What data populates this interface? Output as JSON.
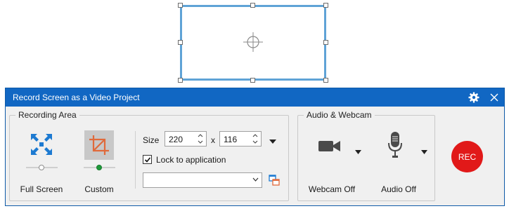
{
  "window": {
    "title": "Record Screen as a Video Project"
  },
  "icons": {
    "settings": "gear-icon",
    "close": "close-icon"
  },
  "recording_area": {
    "legend": "Recording Area",
    "full_screen_label": "Full Screen",
    "custom_label": "Custom",
    "size_label": "Size",
    "width_value": "220",
    "times": "x",
    "height_value": "116",
    "lock_label": "Lock to application",
    "lock_checked": true,
    "application_value": ""
  },
  "audio_webcam": {
    "legend": "Audio & Webcam",
    "webcam_label": "Webcam Off",
    "audio_label": "Audio Off"
  },
  "rec_button": {
    "label": "REC"
  },
  "colors": {
    "titlebar": "#1167c3",
    "accent_blue": "#1d7ad1",
    "custom_active": "#e06a3b",
    "rec": "#e11919",
    "selection_border": "#5fa3d6"
  }
}
